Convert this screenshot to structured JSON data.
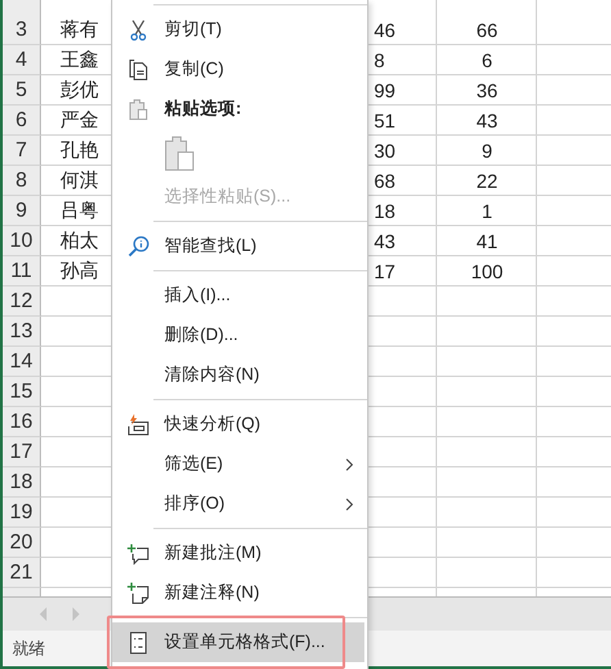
{
  "sheet": {
    "rows": [
      {
        "header": "3",
        "cells": [
          "蒋有",
          "46",
          "66"
        ]
      },
      {
        "header": "4",
        "cells": [
          "王鑫",
          "8",
          "6"
        ]
      },
      {
        "header": "5",
        "cells": [
          "彭优",
          "99",
          "36"
        ]
      },
      {
        "header": "6",
        "cells": [
          "严金",
          "51",
          "43"
        ]
      },
      {
        "header": "7",
        "cells": [
          "孔艳",
          "30",
          "9"
        ]
      },
      {
        "header": "8",
        "cells": [
          "何淇",
          "68",
          "22"
        ]
      },
      {
        "header": "9",
        "cells": [
          "吕粤",
          "18",
          "1"
        ]
      },
      {
        "header": "10",
        "cells": [
          "柏太",
          "43",
          "41"
        ]
      },
      {
        "header": "11",
        "cells": [
          "孙高",
          "17",
          "100"
        ]
      },
      {
        "header": "12",
        "cells": []
      },
      {
        "header": "13",
        "cells": []
      },
      {
        "header": "14",
        "cells": []
      },
      {
        "header": "15",
        "cells": []
      },
      {
        "header": "16",
        "cells": []
      },
      {
        "header": "17",
        "cells": []
      },
      {
        "header": "18",
        "cells": []
      },
      {
        "header": "19",
        "cells": []
      },
      {
        "header": "20",
        "cells": []
      },
      {
        "header": "21",
        "cells": []
      }
    ]
  },
  "status_bar": {
    "text": "就绪"
  },
  "context_menu": {
    "items": [
      {
        "kind": "separator"
      },
      {
        "kind": "command",
        "label": "剪切(T)",
        "disabled": false,
        "submenu": false,
        "highlighted": false
      },
      {
        "kind": "command",
        "label": "复制(C)",
        "disabled": false,
        "submenu": false,
        "highlighted": false
      },
      {
        "kind": "heading",
        "label": "粘贴选项:"
      },
      {
        "kind": "paste-options",
        "disabled": true
      },
      {
        "kind": "command",
        "label": "选择性粘贴(S)...",
        "disabled": true,
        "submenu": false,
        "highlighted": false
      },
      {
        "kind": "separator"
      },
      {
        "kind": "command",
        "label": "智能查找(L)",
        "disabled": false,
        "submenu": false,
        "highlighted": false
      },
      {
        "kind": "separator"
      },
      {
        "kind": "command",
        "label": "插入(I)...",
        "disabled": false,
        "submenu": false,
        "highlighted": false
      },
      {
        "kind": "command",
        "label": "删除(D)...",
        "disabled": false,
        "submenu": false,
        "highlighted": false
      },
      {
        "kind": "command",
        "label": "清除内容(N)",
        "disabled": false,
        "submenu": false,
        "highlighted": false
      },
      {
        "kind": "separator"
      },
      {
        "kind": "command",
        "label": "快速分析(Q)",
        "disabled": false,
        "submenu": false,
        "highlighted": false
      },
      {
        "kind": "command",
        "label": "筛选(E)",
        "disabled": false,
        "submenu": true,
        "highlighted": false
      },
      {
        "kind": "command",
        "label": "排序(O)",
        "disabled": false,
        "submenu": true,
        "highlighted": false
      },
      {
        "kind": "separator"
      },
      {
        "kind": "command",
        "label": "新建批注(M)",
        "disabled": false,
        "submenu": false,
        "highlighted": false
      },
      {
        "kind": "command",
        "label": "新建注释(N)",
        "disabled": false,
        "submenu": false,
        "highlighted": false
      },
      {
        "kind": "separator"
      },
      {
        "kind": "command",
        "label": "设置单元格格式(F)...",
        "disabled": false,
        "submenu": false,
        "highlighted": true
      }
    ]
  }
}
